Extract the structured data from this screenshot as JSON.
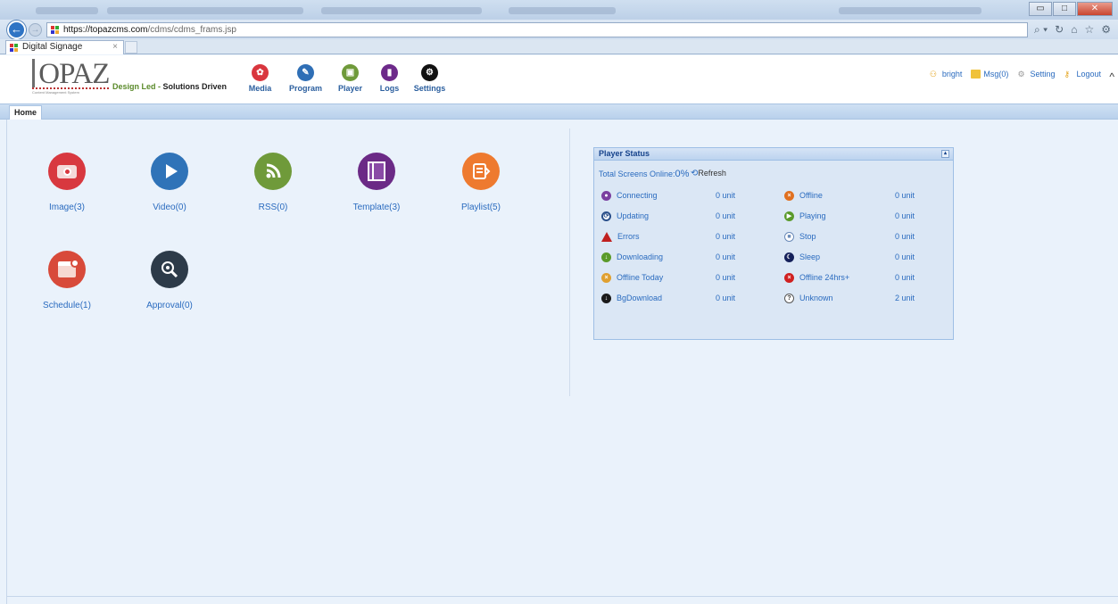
{
  "browser": {
    "url_host": "https://topazcms.com",
    "url_path": "/cdms/cdms_frams.jsp",
    "tab_title": "Digital Signage",
    "tab_close": "×",
    "tools": [
      "⌕ ▾",
      "↻",
      "⌂",
      "☆",
      "⚙"
    ],
    "window_buttons": [
      "▭",
      "□",
      "✕"
    ]
  },
  "app": {
    "logo_text": "OPAZ",
    "logo_sub": "Content Management System",
    "tagline_a": "Design Led - ",
    "tagline_b": "Solutions Driven",
    "nav": [
      {
        "label": "Media",
        "icon": "media-icon",
        "color": "#d9363e",
        "glyph": "✿"
      },
      {
        "label": "Program",
        "icon": "program-icon",
        "color": "#2f6fb6",
        "glyph": "✎"
      },
      {
        "label": "Player",
        "icon": "player-icon",
        "color": "#6f9a3a",
        "glyph": "▣"
      },
      {
        "label": "Logs",
        "icon": "logs-icon",
        "color": "#6d2a8a",
        "glyph": "▮"
      },
      {
        "label": "Settings",
        "icon": "settings-icon",
        "color": "#111111",
        "glyph": "⚙"
      }
    ],
    "user": {
      "name": "bright",
      "msg": "Msg(0)",
      "setting": "Setting",
      "logout": "Logout"
    },
    "collapse": "^",
    "home_tab": "Home"
  },
  "shortcuts": [
    {
      "label": "Image(3)",
      "icon": "camera-icon",
      "color": "#d8383f",
      "glyph": "◙"
    },
    {
      "label": "Video(0)",
      "icon": "play-icon",
      "color": "#2f73b8",
      "glyph": "▶"
    },
    {
      "label": "RSS(0)",
      "icon": "rss-icon",
      "color": "#6f9a3a",
      "glyph": "◠"
    },
    {
      "label": "Template(3)",
      "icon": "template-icon",
      "color": "#6b2a86",
      "glyph": "▥"
    },
    {
      "label": "Playlist(5)",
      "icon": "playlist-icon",
      "color": "#ee7a2f",
      "glyph": "☰"
    },
    {
      "label": "Schedule(1)",
      "icon": "calendar-icon",
      "color": "#d84a3a",
      "glyph": "▦"
    },
    {
      "label": "Approval(0)",
      "icon": "approval-search-icon",
      "color": "#2d3b49",
      "glyph": "⚙"
    }
  ],
  "player_status": {
    "title": "Player Status",
    "collapse_tool": "▴",
    "online_label": "Total Screens Online:",
    "online_pct": "0%",
    "refresh": "Refresh",
    "left": [
      {
        "label": "Connecting",
        "value": "0 unit",
        "icon": "connecting-icon",
        "color": "#7a3fa0",
        "glyph": "●"
      },
      {
        "label": "Updating",
        "value": "0 unit",
        "icon": "updating-icon",
        "color": "#2a4f8a",
        "glyph": "⟳"
      },
      {
        "label": "Errors",
        "value": "0 unit",
        "icon": "error-icon",
        "color": "#c02020",
        "glyph": "!"
      },
      {
        "label": "Downloading",
        "value": "0 unit",
        "icon": "downloading-icon",
        "color": "#5a9a2a",
        "glyph": "↓"
      },
      {
        "label": "Offline Today",
        "value": "0 unit",
        "icon": "offline-today-icon",
        "color": "#e0a030",
        "glyph": "×"
      },
      {
        "label": "BgDownload",
        "value": "0 unit",
        "icon": "bgdownload-icon",
        "color": "#1a1a1a",
        "glyph": "↓"
      }
    ],
    "right": [
      {
        "label": "Offline",
        "value": "0 unit",
        "icon": "offline-icon",
        "color": "#e07020",
        "glyph": "×"
      },
      {
        "label": "Playing",
        "value": "0 unit",
        "icon": "playing-icon",
        "color": "#5a9a2a",
        "glyph": "▶"
      },
      {
        "label": "Stop",
        "value": "0 unit",
        "icon": "stop-icon",
        "color": "#6a8ab8",
        "glyph": "■"
      },
      {
        "label": "Sleep",
        "value": "0 unit",
        "icon": "sleep-icon",
        "color": "#14205a",
        "glyph": "☾"
      },
      {
        "label": "Offline 24hrs+",
        "value": "0 unit",
        "icon": "offline-24hrs-icon",
        "color": "#d02020",
        "glyph": "×"
      },
      {
        "label": "Unknown",
        "value": "2 unit",
        "icon": "unknown-icon",
        "color": "#ffffff",
        "glyph": "?"
      }
    ]
  }
}
